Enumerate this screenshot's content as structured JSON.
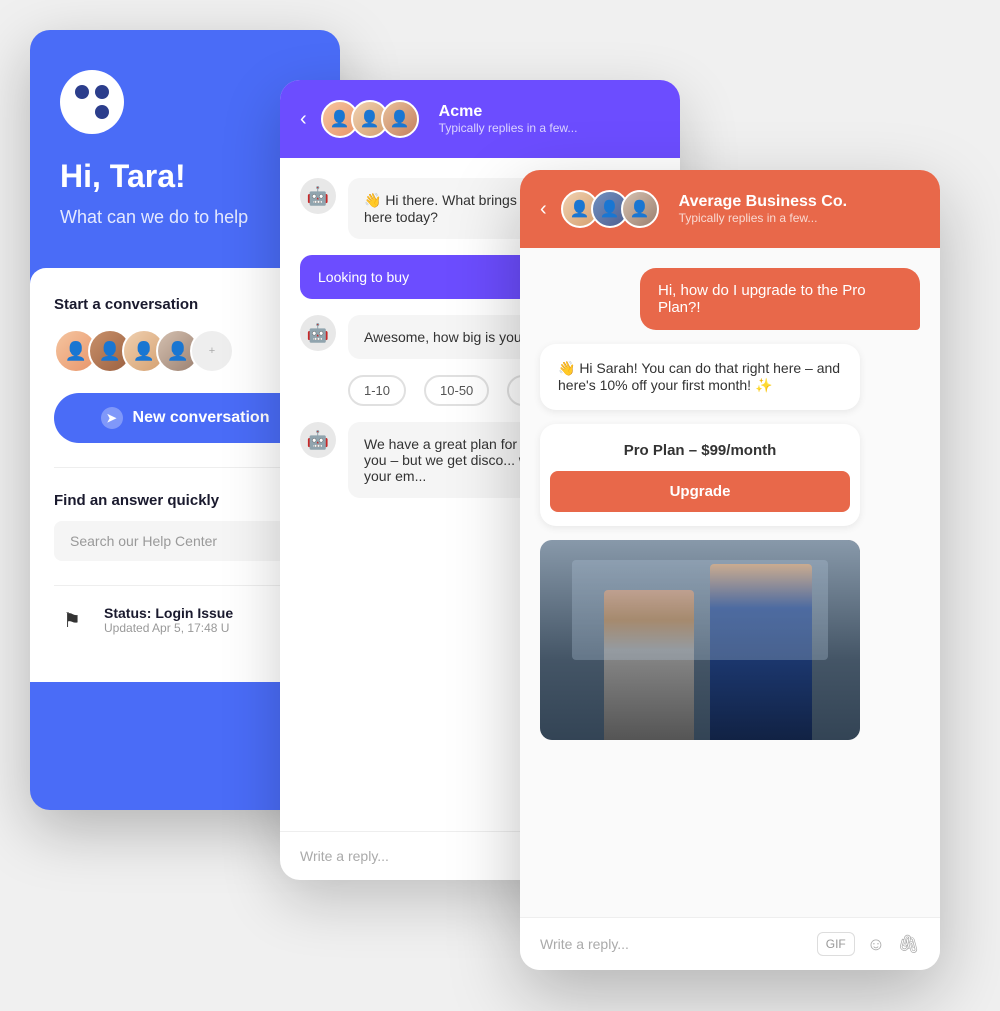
{
  "panel_blue": {
    "logo_alt": "App logo",
    "greeting": "Hi, Tara!",
    "subtitle": "What can we do to help",
    "start_conversation_label": "Start a conversation",
    "new_conversation_btn": "New conversation",
    "find_answer_label": "Find an answer quickly",
    "search_placeholder": "Search our Help Center",
    "status_title": "Status: Login Issue",
    "status_updated": "Updated Apr 5, 17:48 U"
  },
  "panel_chat1": {
    "header_name": "Acme",
    "header_sub": "Typically replies in a few...",
    "back_arrow": "‹",
    "msg1": "👋 Hi there. What brings you here today?",
    "msg_option": "Looking to buy",
    "msg2_bot": "Awesome, how big is your team?",
    "option1": "1-10",
    "option2": "10-50",
    "msg3_bot": "We have a great plan for teams you – but we get disco... what's your em...",
    "reply_placeholder": "Write a reply..."
  },
  "panel_chat2": {
    "header_name": "Average Business Co.",
    "header_sub": "Typically replies in a few...",
    "back_arrow": "‹",
    "msg_user": "Hi, how do I upgrade to the Pro Plan?!",
    "msg_bot": "👋 Hi Sarah! You can do that right here – and here's 10% off your first month! ✨",
    "upgrade_title": "Pro Plan – $99/month",
    "upgrade_btn": "Upgrade",
    "reply_placeholder": "Write a reply...",
    "gif_btn": "GIF",
    "emoji_icon": "☺",
    "attach_icon": "🖇"
  }
}
